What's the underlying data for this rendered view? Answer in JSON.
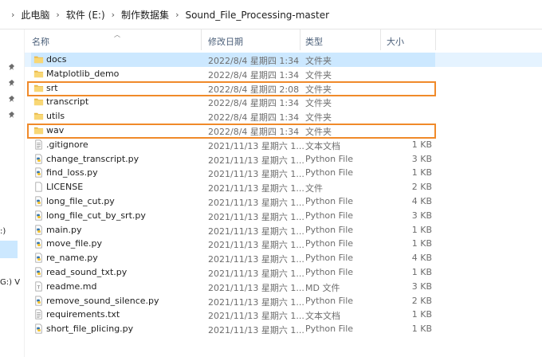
{
  "breadcrumb": [
    "此电脑",
    "软件 (E:)",
    "制作数据集",
    "Sound_File_Processing-master"
  ],
  "columns": {
    "name": "名称",
    "date": "修改日期",
    "type": "类型",
    "size": "大小"
  },
  "left_pane": {
    "drive_label_1": ":)",
    "drive_label_2": "G:) V"
  },
  "files": [
    {
      "name": "docs",
      "date": "2022/8/4 星期四 1:34",
      "type": "文件夹",
      "size": "",
      "icon": "folder-icon"
    },
    {
      "name": "Matplotlib_demo",
      "date": "2022/8/4 星期四 1:34",
      "type": "文件夹",
      "size": "",
      "icon": "folder-icon"
    },
    {
      "name": "srt",
      "date": "2022/8/4 星期四 2:08",
      "type": "文件夹",
      "size": "",
      "icon": "folder-icon"
    },
    {
      "name": "transcript",
      "date": "2022/8/4 星期四 1:34",
      "type": "文件夹",
      "size": "",
      "icon": "folder-icon"
    },
    {
      "name": "utils",
      "date": "2022/8/4 星期四 1:34",
      "type": "文件夹",
      "size": "",
      "icon": "folder-icon"
    },
    {
      "name": "wav",
      "date": "2022/8/4 星期四 1:34",
      "type": "文件夹",
      "size": "",
      "icon": "folder-icon"
    },
    {
      "name": ".gitignore",
      "date": "2021/11/13 星期六 1...",
      "type": "文本文档",
      "size": "1 KB",
      "icon": "text-file-icon"
    },
    {
      "name": "change_transcript.py",
      "date": "2021/11/13 星期六 1...",
      "type": "Python File",
      "size": "3 KB",
      "icon": "python-file-icon"
    },
    {
      "name": "find_loss.py",
      "date": "2021/11/13 星期六 1...",
      "type": "Python File",
      "size": "1 KB",
      "icon": "python-file-icon"
    },
    {
      "name": "LICENSE",
      "date": "2021/11/13 星期六 1...",
      "type": "文件",
      "size": "2 KB",
      "icon": "blank-file-icon"
    },
    {
      "name": "long_file_cut.py",
      "date": "2021/11/13 星期六 1...",
      "type": "Python File",
      "size": "4 KB",
      "icon": "python-file-icon"
    },
    {
      "name": "long_file_cut_by_srt.py",
      "date": "2021/11/13 星期六 1...",
      "type": "Python File",
      "size": "3 KB",
      "icon": "python-file-icon"
    },
    {
      "name": "main.py",
      "date": "2021/11/13 星期六 1...",
      "type": "Python File",
      "size": "1 KB",
      "icon": "python-file-icon"
    },
    {
      "name": "move_file.py",
      "date": "2021/11/13 星期六 1...",
      "type": "Python File",
      "size": "1 KB",
      "icon": "python-file-icon"
    },
    {
      "name": "re_name.py",
      "date": "2021/11/13 星期六 1...",
      "type": "Python File",
      "size": "4 KB",
      "icon": "python-file-icon"
    },
    {
      "name": "read_sound_txt.py",
      "date": "2021/11/13 星期六 1...",
      "type": "Python File",
      "size": "1 KB",
      "icon": "python-file-icon"
    },
    {
      "name": "readme.md",
      "date": "2021/11/13 星期六 1...",
      "type": "MD 文件",
      "size": "3 KB",
      "icon": "markdown-file-icon"
    },
    {
      "name": "remove_sound_silence.py",
      "date": "2021/11/13 星期六 1...",
      "type": "Python File",
      "size": "2 KB",
      "icon": "python-file-icon"
    },
    {
      "name": "requirements.txt",
      "date": "2021/11/13 星期六 1...",
      "type": "文本文档",
      "size": "1 KB",
      "icon": "text-file-icon"
    },
    {
      "name": "short_file_plicing.py",
      "date": "2021/11/13 星期六 1...",
      "type": "Python File",
      "size": "1 KB",
      "icon": "python-file-icon"
    }
  ],
  "selected_row": 0,
  "annotation_color": "#f08a2a"
}
